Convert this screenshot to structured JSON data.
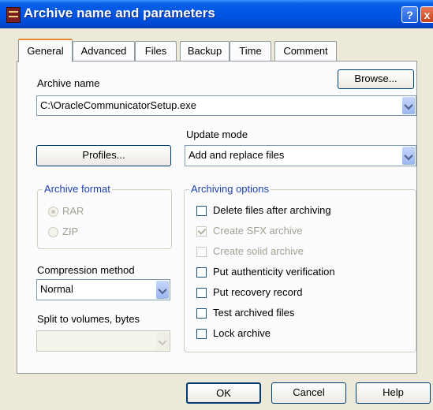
{
  "window": {
    "title": "Archive name and parameters",
    "help_label": "?",
    "close_label": "x"
  },
  "tabs": [
    "General",
    "Advanced",
    "Files",
    "Backup",
    "Time",
    "Comment"
  ],
  "archive_name": {
    "label": "Archive name",
    "value": "C:\\OracleCommunicatorSetup.exe",
    "browse_label": "Browse..."
  },
  "profiles_label": "Profiles...",
  "update_mode": {
    "label": "Update mode",
    "value": "Add and replace files"
  },
  "archive_format": {
    "title": "Archive format",
    "options": [
      "RAR",
      "ZIP"
    ],
    "selected": "RAR"
  },
  "compression": {
    "label": "Compression method",
    "value": "Normal"
  },
  "split": {
    "label": "Split to volumes, bytes",
    "value": ""
  },
  "options": {
    "title": "Archiving options",
    "items": [
      {
        "label": "Delete files after archiving",
        "checked": false,
        "enabled": true
      },
      {
        "label": "Create SFX archive",
        "checked": true,
        "enabled": false
      },
      {
        "label": "Create solid archive",
        "checked": false,
        "enabled": false
      },
      {
        "label": "Put authenticity verification",
        "checked": false,
        "enabled": true
      },
      {
        "label": "Put recovery record",
        "checked": false,
        "enabled": true
      },
      {
        "label": "Test archived files",
        "checked": false,
        "enabled": true
      },
      {
        "label": "Lock archive",
        "checked": false,
        "enabled": true
      }
    ]
  },
  "buttons": {
    "ok": "OK",
    "cancel": "Cancel",
    "help": "Help"
  }
}
